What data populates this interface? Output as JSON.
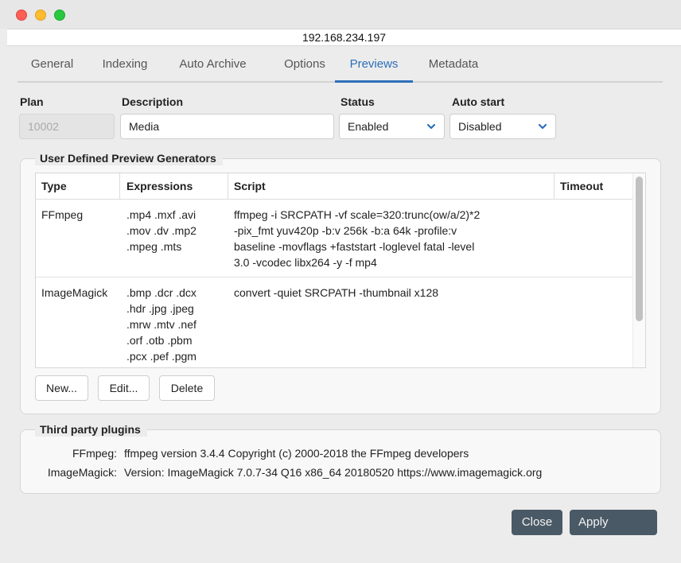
{
  "window": {
    "address": "192.168.234.197"
  },
  "tabs": [
    {
      "label": "General"
    },
    {
      "label": "Indexing"
    },
    {
      "label": "Auto Archive"
    },
    {
      "label": "Options"
    },
    {
      "label": "Previews",
      "active": true
    },
    {
      "label": "Metadata"
    }
  ],
  "form": {
    "plan": {
      "label": "Plan",
      "value": "10002"
    },
    "description": {
      "label": "Description",
      "value": "Media"
    },
    "status": {
      "label": "Status",
      "value": "Enabled"
    },
    "auto_start": {
      "label": "Auto start",
      "value": "Disabled"
    }
  },
  "generators": {
    "title": "User Defined Preview Generators",
    "columns": [
      "Type",
      "Expressions",
      "Script",
      "Timeout"
    ],
    "rows": [
      {
        "type": "FFmpeg",
        "expressions": ".mp4 .mxf .avi\n.mov .dv .mp2\n.mpeg .mts",
        "script": "ffmpeg -i SRCPATH -vf scale=320:trunc(ow/a/2)*2\n-pix_fmt yuv420p -b:v 256k -b:a 64k -profile:v\nbaseline -movflags +faststart -loglevel fatal -level\n3.0 -vcodec libx264 -y -f mp4",
        "timeout": ""
      },
      {
        "type": "ImageMagick",
        "expressions": ".bmp .dcr .dcx\n.hdr .jpg .jpeg\n.mrw .mtv .nef\n.orf .otb .pbm\n.pcx .pef .pgm",
        "script": "convert -quiet SRCPATH -thumbnail x128",
        "timeout": ""
      }
    ],
    "buttons": {
      "new": "New...",
      "edit": "Edit...",
      "delete": "Delete"
    }
  },
  "plugins": {
    "title": "Third party plugins",
    "items": [
      {
        "name": "FFmpeg:",
        "value": "ffmpeg version 3.4.4 Copyright (c) 2000-2018 the FFmpeg developers"
      },
      {
        "name": "ImageMagick:",
        "value": "Version: ImageMagick 7.0.7-34 Q16 x86_64 20180520 https://www.imagemagick.org"
      }
    ]
  },
  "footer": {
    "close": "Close",
    "apply": "Apply"
  },
  "colors": {
    "accent": "#2d6fb9",
    "dark_button": "#4a5966"
  }
}
